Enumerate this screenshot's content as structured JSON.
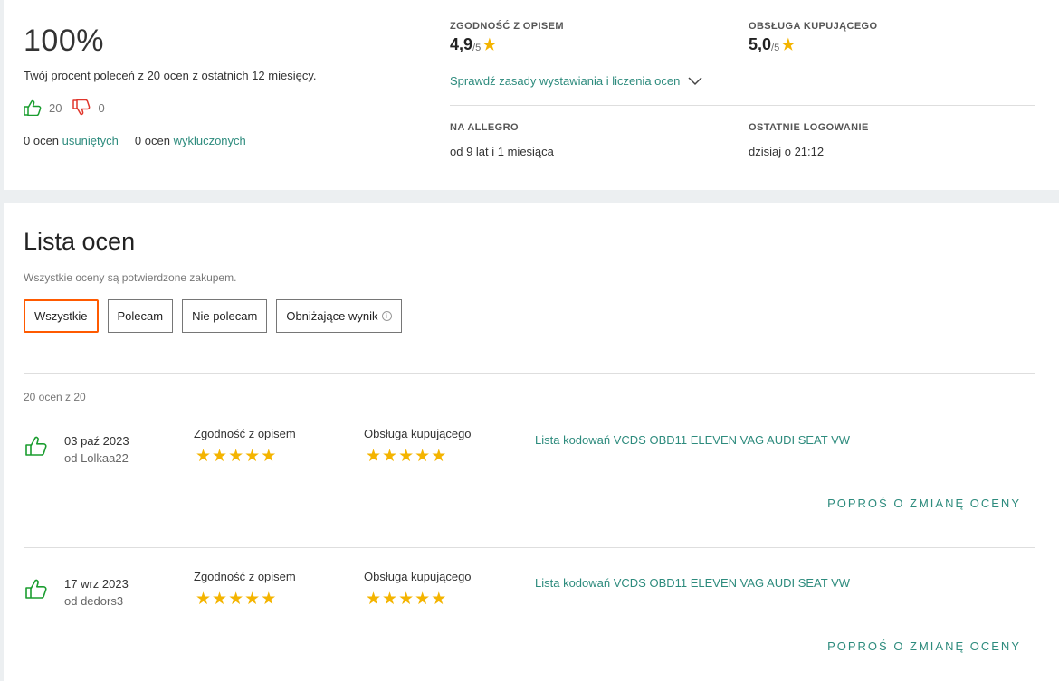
{
  "summary": {
    "percent": "100%",
    "description": "Twój procent poleceń z 20 ocen z ostatnich 12 miesięcy.",
    "positive_count": "20",
    "negative_count": "0",
    "removed_prefix": "0 ocen",
    "removed_link": "usuniętych",
    "excluded_prefix": "0 ocen",
    "excluded_link": "wykluczonych",
    "accuracy_label": "ZGODNOŚĆ Z OPISEM",
    "accuracy_score": "4,9",
    "accuracy_of": "/5",
    "service_label": "OBSŁUGA KUPUJĄCEGO",
    "service_score": "5,0",
    "service_of": "/5",
    "rules_link": "Sprawdź zasady wystawiania i liczenia ocen",
    "on_allegro_label": "NA ALLEGRO",
    "on_allegro_value": "od 9 lat i 1 miesiąca",
    "last_login_label": "OSTATNIE LOGOWANIE",
    "last_login_value": "dzisiaj o 21:12",
    "star_color": "#f4b400",
    "positive_color": "#1a9d2f",
    "negative_color": "#e0352b"
  },
  "ratings": {
    "title": "Lista ocen",
    "subtitle": "Wszystkie oceny są potwierdzone zakupem.",
    "filters": [
      "Wszystkie",
      "Polecam",
      "Nie polecam",
      "Obniżające wynik"
    ],
    "active_filter": "Wszystkie",
    "count_text": "20 ocen z 20",
    "accent_color": "#ff5a00",
    "entries": [
      {
        "date": "03 paź 2023",
        "author": "od Lolkaa22",
        "accuracy_label": "Zgodność z opisem",
        "service_label": "Obsługa kupującego",
        "accuracy_stars": 5,
        "service_stars": 5,
        "product": "Lista kodowań VCDS OBD11 ELEVEN VAG AUDI SEAT VW",
        "action": "POPROŚ O ZMIANĘ OCENY"
      },
      {
        "date": "17 wrz 2023",
        "author": "od dedors3",
        "accuracy_label": "Zgodność z opisem",
        "service_label": "Obsługa kupującego",
        "accuracy_stars": 5,
        "service_stars": 5,
        "product": "Lista kodowań VCDS OBD11 ELEVEN VAG AUDI SEAT VW",
        "action": "POPROŚ O ZMIANĘ OCENY"
      }
    ]
  }
}
